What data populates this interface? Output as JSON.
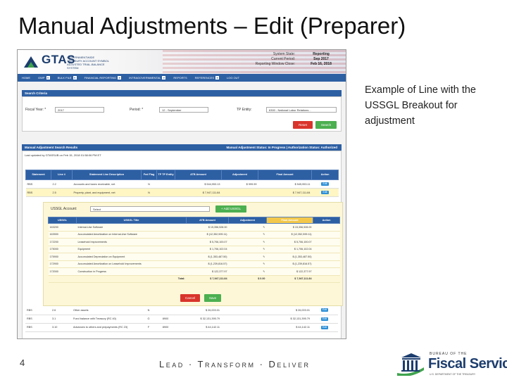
{
  "slide": {
    "title": "Manual Adjustments – Edit (Preparer)",
    "callout": "Example of Line with the USSGL Breakout for adjustment",
    "page_number": "4",
    "tagline": "Lead · Transform · Deliver"
  },
  "app": {
    "logo": "GTAS",
    "logo_sub": "GOVERNMENTWIDE TREASURY ACCOUNT SYMBOL ADJUSTED TRIAL-BALANCE SYSTEM",
    "system_labels": [
      "System State:",
      "Current Period:",
      "Reporting Window Close:"
    ],
    "system_values": [
      "Reporting",
      "Sep 2017",
      "Feb 16, 2018"
    ],
    "nav": [
      "HOME",
      "GWP",
      "BULK FILE",
      "FINANCIAL REPORTING",
      "INTRAGOVERNMENTAL",
      "REPORTS",
      "REFERENCES",
      "LOG OUT"
    ]
  },
  "search": {
    "header": "Search Criteria",
    "fiscal_year_label": "Fiscal Year: *",
    "fiscal_year_value": "2017",
    "period_label": "Period: *",
    "period_value": "12 - September",
    "entity_label": "TP Entity:",
    "entity_value": "6300 - National Labor Relations...",
    "reset_label": "Reset",
    "search_label": "Search"
  },
  "results": {
    "header": "Manual Adjustment Search Results",
    "status": "Manual Adjustment Status: In Progress  |  Authorization Status: Authorized",
    "last_updated": "Last updated by GTASSUB on Feb 15, 2018 01:58:06 PM ET",
    "columns": [
      "Statement",
      "Line #",
      "Statement Line Description",
      "Fed Flag",
      "TP TP Entity",
      "ATB Amount",
      "Adjustment",
      "Final Amount",
      "Action"
    ],
    "rows": [
      {
        "stmt": "RBS",
        "line": "2.2",
        "desc": "Accounts and taxes receivable, net",
        "fed": "N",
        "tp": "",
        "atb": "$ 544,953.13",
        "adj": "$ 999.99",
        "final": "$ 545,953.11",
        "action": "Edit"
      },
      {
        "stmt": "RBS",
        "line": "2.5",
        "desc": "Property, plant, and equipment, net",
        "fed": "N",
        "tp": "",
        "atb": "$ 7,947,111.84",
        "adj": "",
        "final": "$ 7,947,111.84",
        "action": "Edit"
      }
    ],
    "bottom_rows": [
      {
        "stmt": "RBS",
        "line": "2.6",
        "desc": "Other assets",
        "fed": "N",
        "tp": "",
        "atb": "$ 26,003.01",
        "final": "$ 26,003.01",
        "action": "Edit"
      },
      {
        "stmt": "RBS",
        "line": "3.1",
        "desc": "Fund balance with Treasury (RC 40)",
        "fed": "G",
        "tp": "8900",
        "atb": "$ 32,131,395.79",
        "final": "$ 32,131,395.79",
        "action": "Edit"
      },
      {
        "stmt": "RBS",
        "line": "3.10",
        "desc": "Advances to others and prepayments (RC 23)",
        "fed": "F",
        "tp": "8900",
        "atb": "$ 44,142.11",
        "final": "$ 44,142.11",
        "action": "Edit"
      }
    ]
  },
  "breakout": {
    "ussgl_label": "USSGL Account:",
    "ussgl_value": "Select",
    "add_label": "Add USSGL",
    "columns": [
      "USSGL",
      "USSGL Title",
      "ATB Amount",
      "Adjustment",
      "Final Amount",
      "Action"
    ],
    "rows": [
      {
        "code": "163200",
        "title": "Internal-Use Software",
        "atb": "$ 15,356,528.00",
        "final": "$ 15,356,528.00"
      },
      {
        "code": "163900",
        "title": "Accumulated Amortization on Internal-Use Software",
        "atb": "$ (12,352,599.11)",
        "final": "$ (12,352,599.11)"
      },
      {
        "code": "172200",
        "title": "Leasehold Improvements",
        "atb": "$ 5,706,100.07",
        "final": "$ 5,706,100.07"
      },
      {
        "code": "175000",
        "title": "Equipment",
        "atb": "$ 1,706,102.04",
        "final": "$ 1,706,102.04"
      },
      {
        "code": "175900",
        "title": "Accumulated Depreciation on Equipment",
        "atb": "$ (1,353,487.50)",
        "final": "$ (1,353,487.50)"
      },
      {
        "code": "172900",
        "title": "Accumulated Amortization on Leasehold Improvements",
        "atb": "$ (1,239,816.57)",
        "final": "$ (1,239,816.57)"
      },
      {
        "code": "172000",
        "title": "Construction in Progress",
        "atb": "$ 122,377.97",
        "final": "$ 122,377.97"
      }
    ],
    "total_label": "Total:",
    "total_atb": "$ 7,947,111.84",
    "total_adj": "$ 0.00",
    "total_final": "$ 7,947,111.84",
    "cancel_label": "Cancel",
    "save_label": "Save"
  },
  "brand": {
    "top": "BUREAU OF THE",
    "name": "Fiscal Service",
    "sub": "U.S. DEPARTMENT OF THE TREASURY"
  },
  "colors": {
    "nav_blue": "#2d5fa3",
    "highlight": "#fff6c4",
    "danger": "#d9342b",
    "success": "#4caf50"
  }
}
